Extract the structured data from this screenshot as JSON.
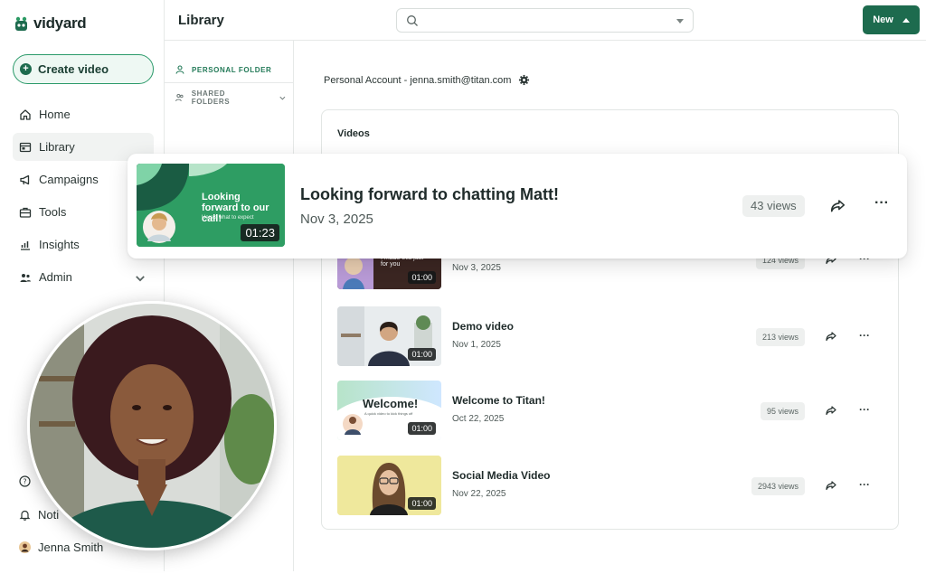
{
  "brand": {
    "name": "vidyard"
  },
  "sidebar": {
    "create_label": "Create video",
    "items": [
      {
        "label": "Home",
        "icon": "home-icon"
      },
      {
        "label": "Library",
        "icon": "library-icon"
      },
      {
        "label": "Campaigns",
        "icon": "megaphone-icon"
      },
      {
        "label": "Tools",
        "icon": "briefcase-icon"
      },
      {
        "label": "Insights",
        "icon": "chart-icon"
      },
      {
        "label": "Admin",
        "icon": "users-icon"
      }
    ],
    "bottom": {
      "help_label": "",
      "notifications_label": "Noti",
      "user_label": "Jenna Smith"
    }
  },
  "folders": {
    "personal": "PERSONAL FOLDER",
    "shared": "SHARED FOLDERS"
  },
  "header": {
    "title": "Library",
    "search_placeholder": "",
    "new_label": "New"
  },
  "account": {
    "text": "Personal Account - jenna.smith@titan.com"
  },
  "videos": {
    "title": "Videos",
    "highlight": {
      "title": "Looking forward to chatting Matt!",
      "date": "Nov 3, 2025",
      "views": "43 views",
      "duration": "01:23",
      "thumb_heading": "Looking forward to our call!",
      "thumb_sub": "Here's what to expect"
    },
    "rows": [
      {
        "title": "",
        "date": "Nov 3, 2025",
        "views": "124 views",
        "duration": "01:00",
        "thumb_text": "I made this just for you"
      },
      {
        "title": "Demo video",
        "date": "Nov 1, 2025",
        "views": "213 views",
        "duration": "01:00"
      },
      {
        "title": "Welcome to Titan!",
        "date": "Oct 22, 2025",
        "views": "95 views",
        "duration": "01:00",
        "thumb_text": "Welcome!",
        "thumb_sub": "A quick video to kick things off"
      },
      {
        "title": "Social Media Video",
        "date": "Nov 22, 2025",
        "views": "2943 views",
        "duration": "01:00"
      }
    ]
  },
  "colors": {
    "brand_green": "#1d6b4e",
    "accent_green": "#2c9a64"
  }
}
